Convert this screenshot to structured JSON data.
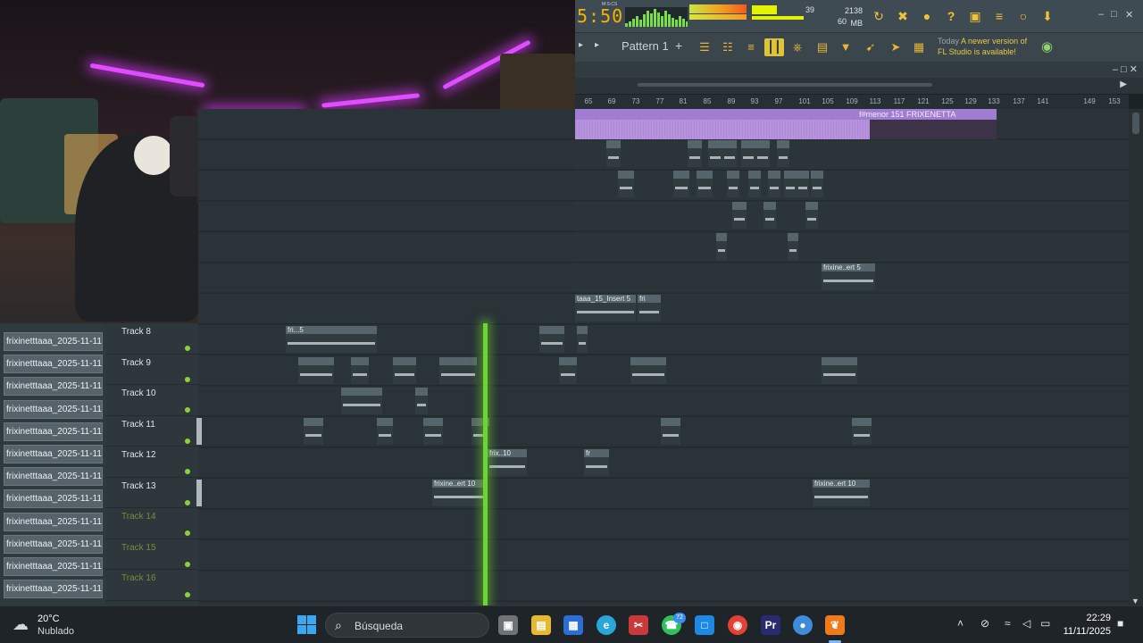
{
  "topbar": {
    "clock": "5:50",
    "clock_unit": "M:S:CS",
    "cpu_value": "39",
    "memory_mb": "2138 MB",
    "polyphony": "60",
    "icons": [
      "record-loop-icon",
      "tuner-icon",
      "microphone-icon",
      "help-icon",
      "save-icon",
      "mixer-link-icon",
      "chat-icon",
      "download-icon"
    ]
  },
  "toolbar2": {
    "pattern_label": "Pattern 1",
    "notice_prefix": "Today",
    "notice_line1": "A newer version of",
    "notice_line2": "FL Studio is available!"
  },
  "ruler": {
    "bars": [
      "65",
      "69",
      "73",
      "77",
      "81",
      "85",
      "89",
      "93",
      "97",
      "101",
      "105",
      "109",
      "113",
      "117",
      "121",
      "125",
      "129",
      "133",
      "137",
      "141",
      "149",
      "153"
    ]
  },
  "vocal_clip": {
    "label": "f#menor 151 FRIXENETTA"
  },
  "upper_clips": [
    {
      "label": "frixine..ert 5"
    },
    {
      "label": "taaa_15_Insert 5"
    },
    {
      "label": "fri"
    }
  ],
  "channels": [
    "frixinetttaaa_2025-11-11...",
    "frixinetttaaa_2025-11-11...",
    "frixinetttaaa_2025-11-11...",
    "frixinetttaaa_2025-11-11...",
    "frixinetttaaa_2025-11-11...",
    "frixinetttaaa_2025-11-11...",
    "frixinetttaaa_2025-11-11...",
    "frixinetttaaa_2025-11-11...",
    "frixinetttaaa_2025-11-11...",
    "frixinetttaaa_2025-11-11...",
    "frixinetttaaa_2025-11-11...",
    "frixinetttaaa_2025-11-11..."
  ],
  "tracks": [
    "Track 8",
    "Track 9",
    "Track 10",
    "Track 11",
    "Track 12",
    "Track 13",
    "Track 14",
    "Track 15",
    "Track 16"
  ],
  "lower_clip_labels": {
    "t8": "fri...5",
    "t12a": "frix..10",
    "t12b": "fr",
    "t13a": "frixine..ert 10",
    "t13b": "frixine..ert 10"
  },
  "taskbar": {
    "temperature": "20°C",
    "weather": "Nublado",
    "search_placeholder": "Búsqueda",
    "whatsapp_badge": "72",
    "time": "22:29",
    "date": "11/11/2025"
  },
  "colors": {
    "accent": "#f4b400",
    "playhead": "#6ed430",
    "vocal_clip": "#a07dd0",
    "panel": "#3f4b52"
  }
}
